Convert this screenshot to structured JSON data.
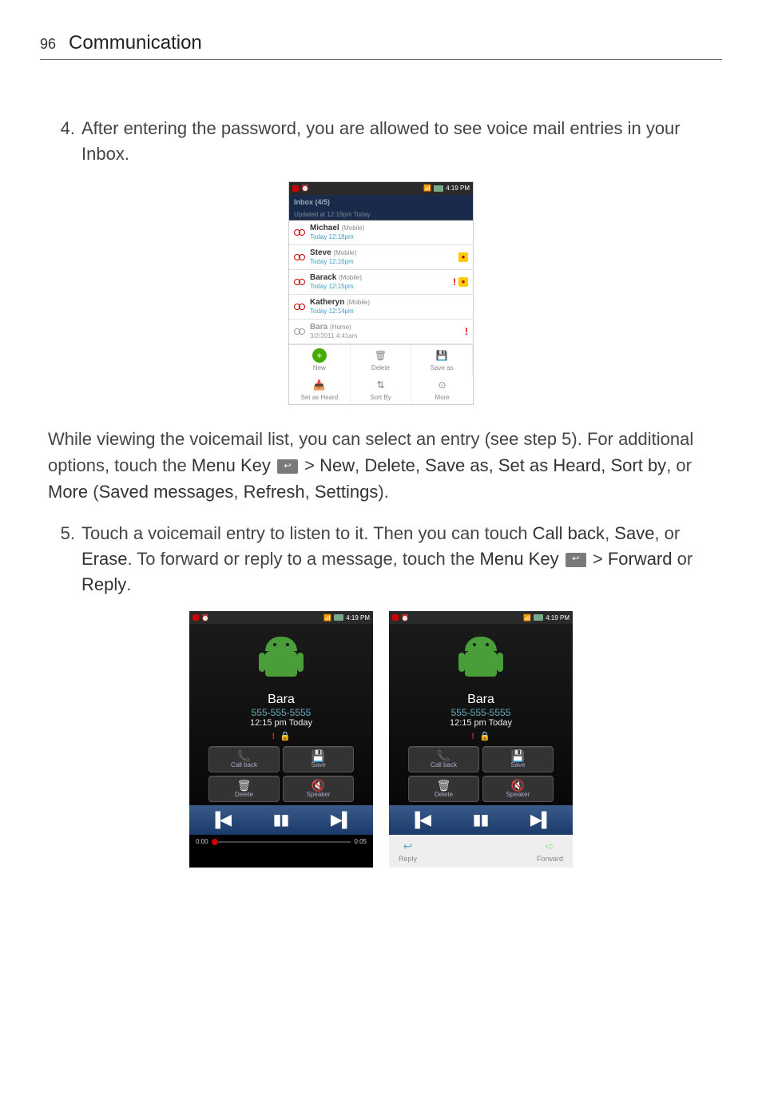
{
  "page": {
    "number": "96",
    "title": "Communication"
  },
  "step4": {
    "num": "4.",
    "text": "After entering the password, you are allowed to see voice mail entries in your Inbox."
  },
  "inbox": {
    "status_time": "4:19 PM",
    "header": "Inbox (4/5)",
    "updated": "Updated at 12:19pm Today",
    "rows": [
      {
        "name": "Michael",
        "type": "(Mobile)",
        "time": "Today 12:18pm",
        "badge": false,
        "excl": false,
        "grey": false
      },
      {
        "name": "Steve",
        "type": "(Mobile)",
        "time": "Today 12:16pm",
        "badge": true,
        "excl": false,
        "grey": false
      },
      {
        "name": "Barack",
        "type": "(Mobile)",
        "time": "Today 12:15pm",
        "badge": true,
        "excl": true,
        "grey": false
      },
      {
        "name": "Katheryn",
        "type": "(Mobile)",
        "time": "Today 12:14pm",
        "badge": false,
        "excl": false,
        "grey": false
      },
      {
        "name": "Bara",
        "type": "(Home)",
        "time": "3/2/2011 4:41am",
        "badge": false,
        "excl": true,
        "grey": true
      }
    ],
    "actions": [
      {
        "label": "New",
        "icon": "+",
        "green": true
      },
      {
        "label": "Delete",
        "icon": "🗑"
      },
      {
        "label": "Save as",
        "icon": "💾"
      },
      {
        "label": "Set as Heard",
        "icon": "📥"
      },
      {
        "label": "Sort By",
        "icon": "⇅"
      },
      {
        "label": "More",
        "icon": "⊙"
      }
    ]
  },
  "para_middle": {
    "a": "While viewing the voicemail list, you can select an entry (see step 5). For additional options, touch the ",
    "menu_key": "Menu Key",
    "b": " > ",
    "new": "New",
    "c": ", ",
    "delete": "Delete, Save as, Set as Heard, Sort by",
    "d": ", or ",
    "more": "More",
    "e": " (",
    "saved": "Saved messages",
    "f": ", ",
    "refresh": "Refresh",
    "g": ", ",
    "settings": "Settings",
    "h": ")."
  },
  "step5": {
    "num": "5.",
    "a": "Touch a voicemail entry to listen to it. Then you can touch ",
    "callback": "Call back",
    "b": ", ",
    "save": "Save",
    "c": ", or ",
    "erase": "Erase",
    "d": ". To forward or reply to a message, touch the ",
    "menu_key": "Menu Key",
    "e": " > ",
    "forward": "Forward",
    "f": " or ",
    "reply": "Reply",
    "g": "."
  },
  "player": {
    "status_time": "4:19 PM",
    "name": "Bara",
    "number": "555-555-5555",
    "time": "12:15 pm Today",
    "btn_callback": "Call back",
    "btn_save": "Save",
    "btn_delete": "Delete",
    "btn_speaker": "Speaker",
    "seek_start": "0:00",
    "seek_end": "0:05",
    "footer_reply": "Reply",
    "footer_forward": "Forward"
  }
}
